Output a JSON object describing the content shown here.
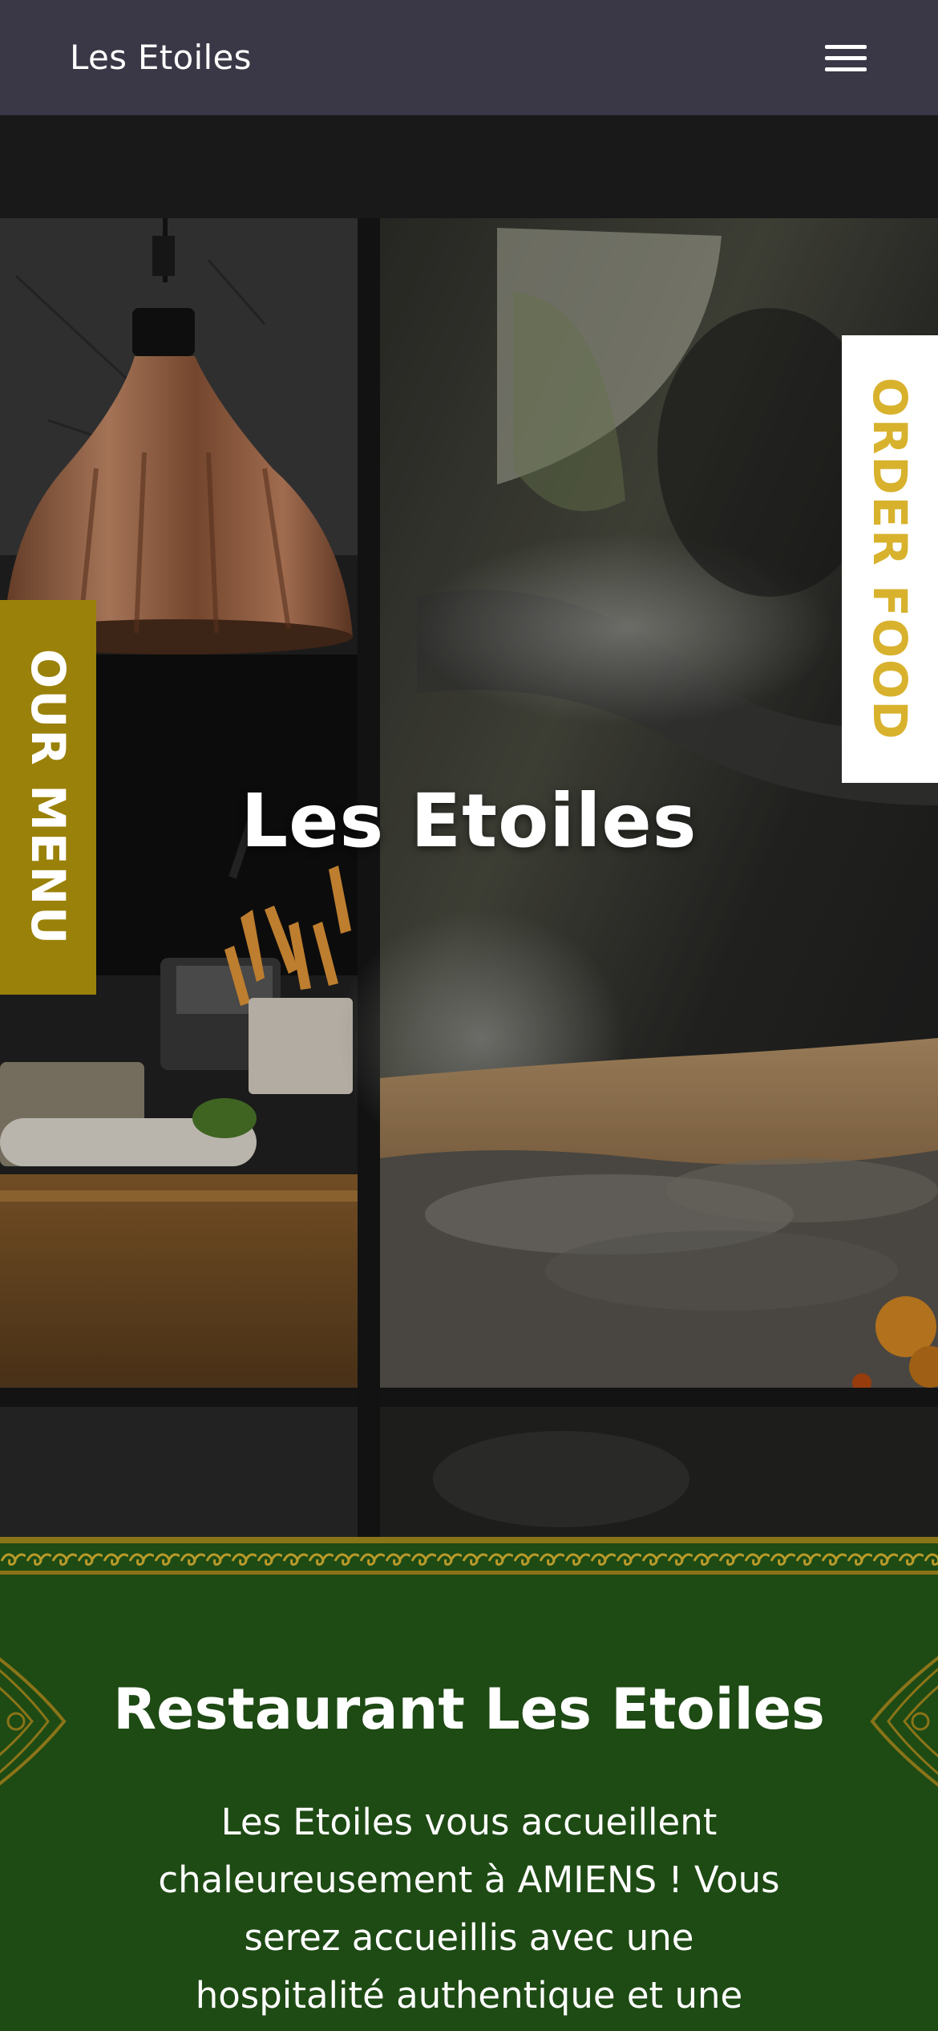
{
  "header": {
    "brand": "Les Etoiles",
    "menu_icon": "hamburger-menu-icon"
  },
  "hero": {
    "title": "Les Etoiles",
    "background": "restaurant-kitchen-photo"
  },
  "side_tabs": {
    "menu_label": "OUR MENU",
    "order_label": "ORDER FOOD"
  },
  "intro": {
    "title": "Restaurant Les Etoiles",
    "text": "Les Etoiles vous accueillent chaleureusement à AMIENS ! Vous serez accueillis avec une hospitalité authentique et une splendide"
  },
  "colors": {
    "nav_bg": "#3a3846",
    "menu_tab": "#9a8109",
    "order_tab_text": "#d8b22d",
    "intro_bg": "#1e4a14",
    "ornament_gold": "#a58a1c"
  }
}
